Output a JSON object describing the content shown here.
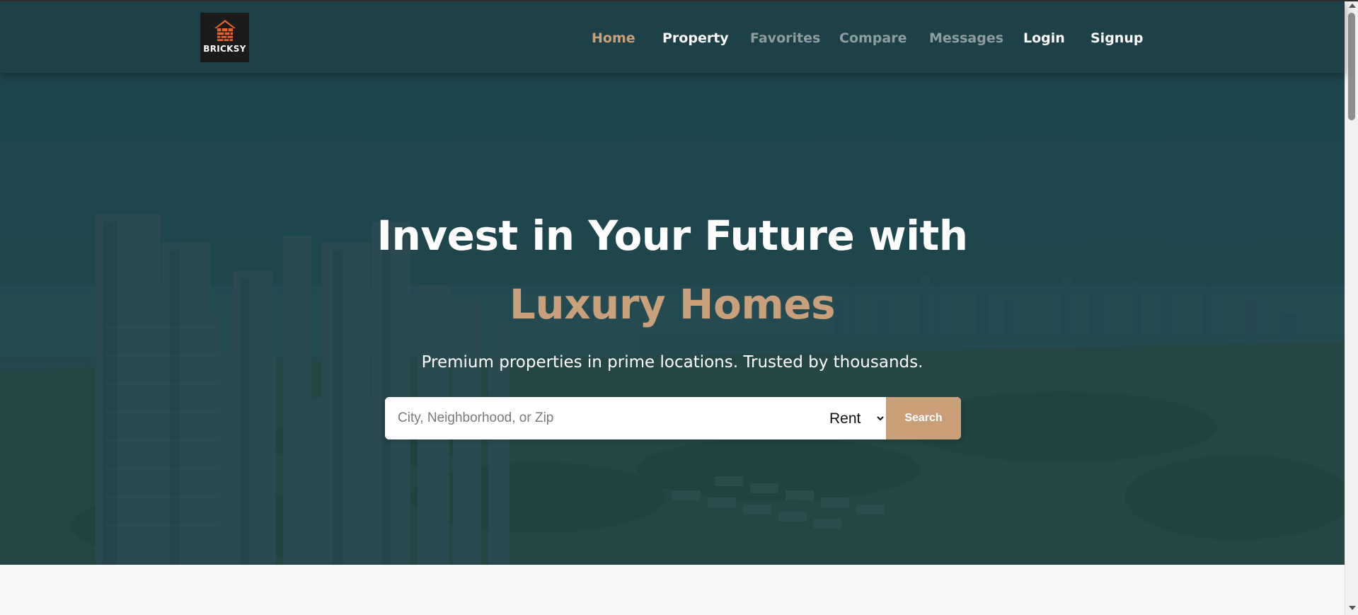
{
  "brand": {
    "name": "BRICKSY",
    "logo_icon": "house-brick-icon",
    "accent": "#e8622c"
  },
  "nav": {
    "items": [
      {
        "label": "Home",
        "state": "active"
      },
      {
        "label": "Property",
        "state": "normal"
      },
      {
        "label": "Favorites",
        "state": "muted"
      },
      {
        "label": "Compare",
        "state": "muted"
      },
      {
        "label": "Messages",
        "state": "muted"
      },
      {
        "label": "Login",
        "state": "normal"
      },
      {
        "label": "Signup",
        "state": "normal"
      }
    ]
  },
  "hero": {
    "title": "Invest in Your Future with",
    "highlight": "Luxury Homes",
    "subtitle": "Premium properties in prime locations. Trusted by thousands."
  },
  "search": {
    "placeholder": "City, Neighborhood, or Zip",
    "value": "",
    "type_selected": "Rent",
    "button_label": "Search"
  },
  "colors": {
    "navbar": "#1c4148",
    "accent": "#c9a07a",
    "muted_link": "#8d9ea1"
  }
}
